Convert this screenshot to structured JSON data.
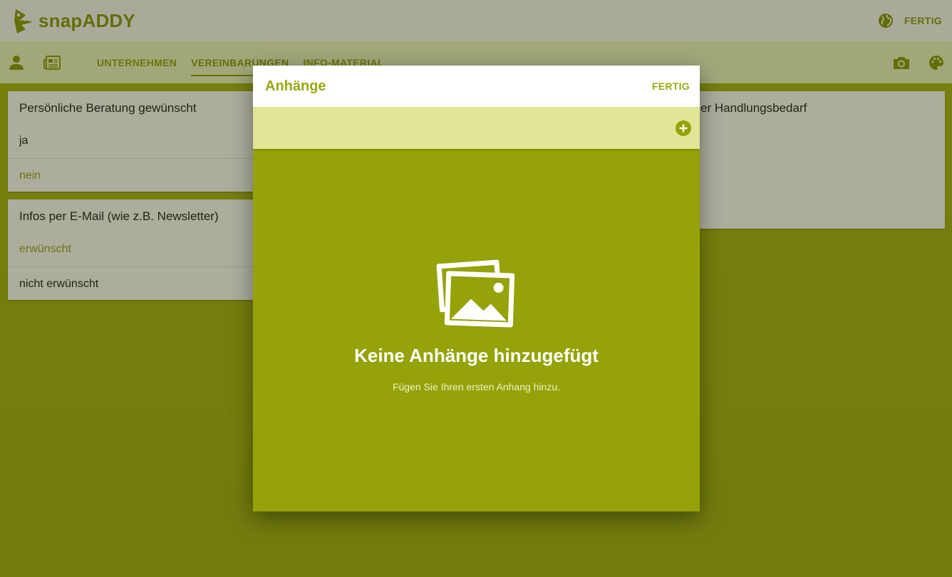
{
  "app": {
    "brand": "snapADDY"
  },
  "topbar": {
    "done_label": "FERTIG",
    "globe_icon": "globe-icon"
  },
  "subbar": {
    "icons": [
      "person-icon",
      "newspaper-icon"
    ],
    "tabs": [
      {
        "label": "UNTERNEHMEN",
        "active": false
      },
      {
        "label": "VEREINBARUNGEN",
        "active": true
      },
      {
        "label": "INFO-MATERIAL",
        "active": false
      }
    ],
    "right_icons": [
      "camera-icon",
      "palette-icon"
    ]
  },
  "cards": [
    {
      "question": "Persönliche Beratung gewünscht",
      "options": [
        {
          "label": "ja",
          "selected": false
        },
        {
          "label": "nein",
          "selected": true
        }
      ]
    },
    {
      "question": "Infos per E-Mail (wie z.B. Newsletter)",
      "options": [
        {
          "label": "erwünscht",
          "selected": true
        },
        {
          "label": "nicht erwünscht",
          "selected": false
        }
      ]
    },
    {
      "question": "er Handlungsbedarf"
    }
  ],
  "modal": {
    "title": "Anhänge",
    "done_label": "FERTIG",
    "add_icon": "add-circle-icon",
    "empty_icon": "image-gallery-icon",
    "empty_title": "Keine Anhänge hinzugefügt",
    "empty_subtitle": "Fügen Sie Ihren ersten Anhang hinzu."
  },
  "colors": {
    "accent": "#95a208",
    "toolbar": "#e0e695",
    "subbar": "#eef5c6"
  }
}
